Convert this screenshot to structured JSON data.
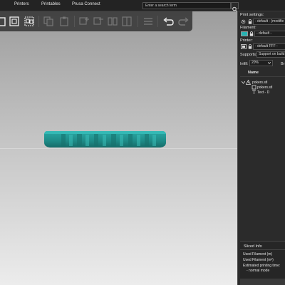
{
  "topbar": {
    "tabs": [
      "Printers",
      "Printables",
      "Prusa Connect"
    ],
    "search_placeholder": "Enter a search term"
  },
  "sidebar": {
    "print_settings_label": "Print settings:",
    "print_settings_value": "- default - (modifie",
    "filament_label": "Filament:",
    "filament_value": "- default -",
    "filament_color": "#26b3b3",
    "printer_label": "Printer:",
    "printer_value": "- default FFF -",
    "supports_label": "Supports:",
    "supports_value": "Support on build",
    "infill_label": "Infill:",
    "infill_value": "20%",
    "brim_label": "Br",
    "object_list_header": "Name",
    "objects": {
      "object_name": "pokers.stl",
      "part_name": "pokers.stl",
      "text_part": "Text - D"
    }
  },
  "sliced_info": {
    "title": "Sliced Info",
    "filament_m": "Used Filament (m)",
    "filament_mm3": "Used Filament (m³)",
    "print_time_label": "Estimated printing time:",
    "normal_mode": "- normal mode"
  },
  "colors": {
    "model_teal": "#1e9a96",
    "accent_orange": "#ed6b21"
  }
}
